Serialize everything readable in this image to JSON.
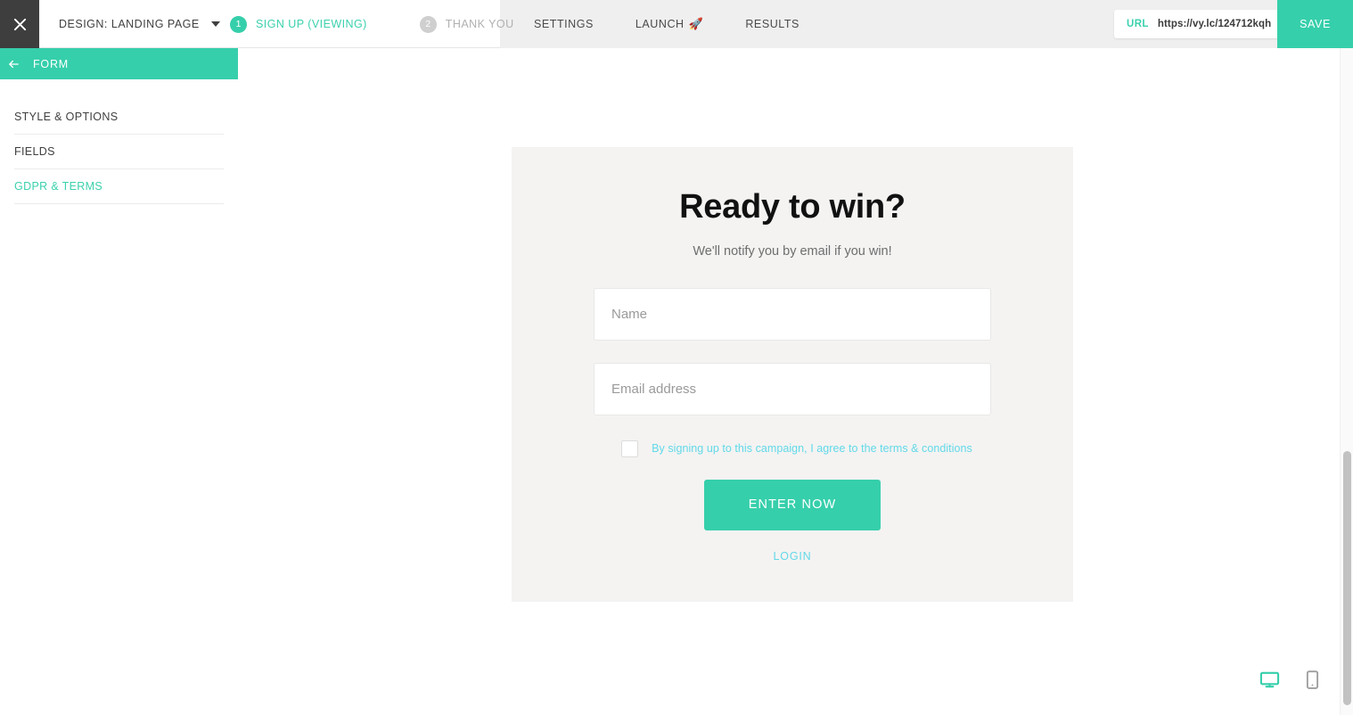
{
  "topbar": {
    "close_icon": "close-icon",
    "design_select": {
      "label": "DESIGN: LANDING PAGE",
      "caret_icon": "chevron-down-icon"
    },
    "steps": [
      {
        "number": "1",
        "label": "SIGN UP (VIEWING)",
        "state": "active"
      },
      {
        "number": "2",
        "label": "THANK YOU",
        "state": "inactive"
      }
    ],
    "nav": [
      {
        "label": "SETTINGS",
        "icon": ""
      },
      {
        "label": "LAUNCH",
        "icon": "🚀"
      },
      {
        "label": "RESULTS",
        "icon": ""
      }
    ],
    "url": {
      "tag": "URL",
      "value": "https://vy.lc/124712kqh",
      "open_icon": "external-link-icon"
    },
    "save_label": "SAVE"
  },
  "sidebar": {
    "header": {
      "back_icon": "arrow-left-icon",
      "title": "FORM"
    },
    "items": [
      {
        "label": "STYLE & OPTIONS",
        "active": false
      },
      {
        "label": "FIELDS",
        "active": false
      },
      {
        "label": "GDPR & TERMS",
        "active": true
      }
    ]
  },
  "form_preview": {
    "headline": "Ready to win?",
    "subhead": "We'll notify you by email if you win!",
    "fields": [
      {
        "name": "name",
        "placeholder": "Name",
        "value": ""
      },
      {
        "name": "email",
        "placeholder": "Email address",
        "value": ""
      }
    ],
    "consent": {
      "checked": false,
      "text": "By signing up to this campaign, I agree to the terms & conditions"
    },
    "cta_label": "ENTER NOW",
    "login_label": "LOGIN"
  },
  "device_toggle": [
    {
      "name": "desktop",
      "icon": "monitor-icon",
      "active": true
    },
    {
      "name": "mobile",
      "icon": "phone-icon",
      "active": false
    }
  ],
  "colors": {
    "accent": "#36cfab",
    "accent_text": "#3bd1ae",
    "link_cyan": "#62d9e8",
    "dark": "#3e3e3e",
    "card_bg": "#f4f3f2",
    "nav_bg": "#efefef"
  }
}
